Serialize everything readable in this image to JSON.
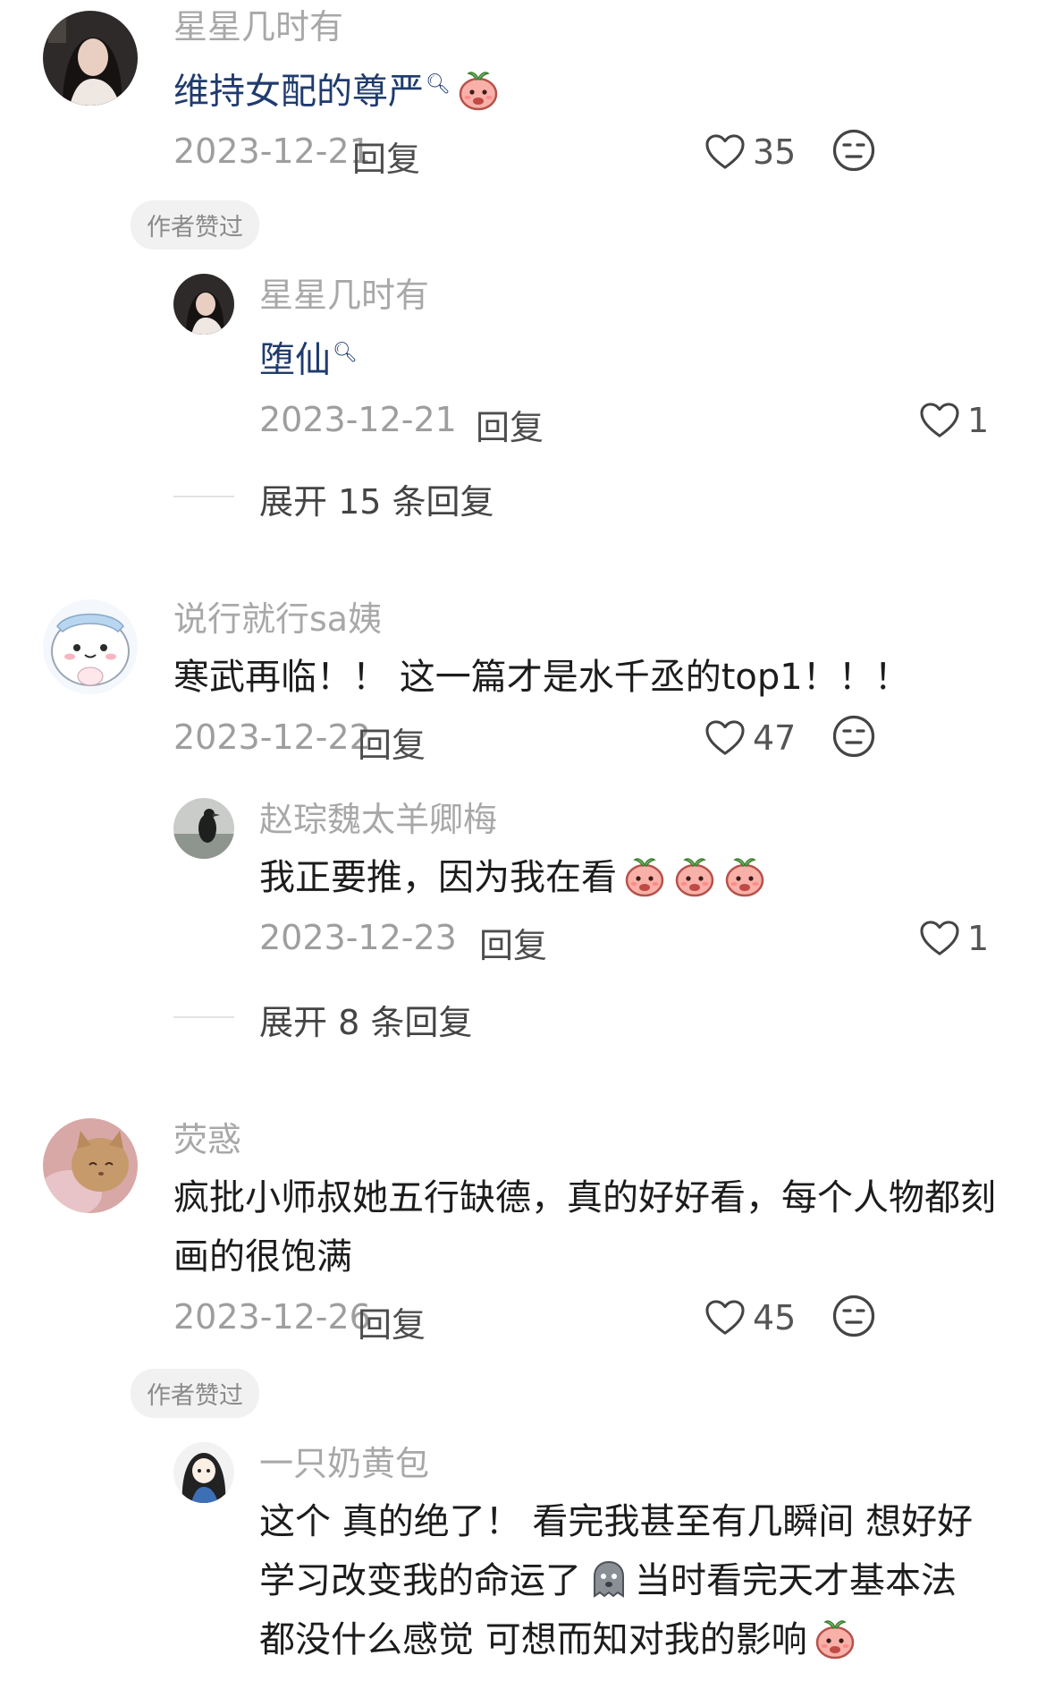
{
  "comments": [
    {
      "username": "星星几时有",
      "text": "维持女配的尊严",
      "date": "2023-12-21",
      "reply_label": "回复",
      "likes": "35",
      "badge": "作者赞过",
      "reply": {
        "username": "星星几时有",
        "text": "堕仙",
        "date": "2023-12-21",
        "reply_label": "回复",
        "likes": "1"
      },
      "expand": "展开 15 条回复"
    },
    {
      "username": "说行就行sa姨",
      "text": "寒武再临！！ 这一篇才是水千丞的top1！！！",
      "date": "2023-12-22",
      "reply_label": "回复",
      "likes": "47",
      "reply": {
        "username": "赵琮魏太羊卿梅",
        "text": "我正要推，因为我在看",
        "date": "2023-12-23",
        "reply_label": "回复",
        "likes": "1"
      },
      "expand": "展开 8 条回复"
    },
    {
      "username": "荧惑",
      "text": "疯批小师叔她五行缺德，真的好好看，每个人物都刻画的很饱满",
      "date": "2023-12-26",
      "reply_label": "回复",
      "likes": "45",
      "badge": "作者赞过",
      "reply": {
        "username": "一只奶黄包",
        "text_line1": "这个 真的绝了！ 看完我甚至有几瞬间 想好好",
        "text_line2a": "学习改变我的命运了",
        "text_line2b": "当时看完天才基本法",
        "text_line3": "都没什么感觉 可想而知对我的影响"
      }
    }
  ],
  "icons": {
    "like": "heart-outline-icon",
    "dislike": "neutral-face-icon",
    "search_mark": "search-icon",
    "emoji_peach": "peach-emoji-icon",
    "emoji_ghost": "ghost-emoji-icon"
  },
  "colors": {
    "username": "#a8a8a8",
    "link_text": "#1f3b6e",
    "date": "#9e9e9e",
    "badge_bg": "#f1f1f1"
  }
}
